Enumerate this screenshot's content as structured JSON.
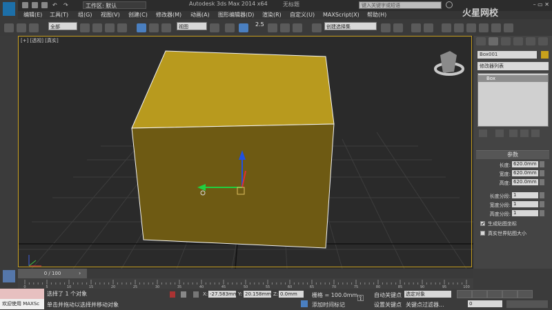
{
  "app": {
    "workspace": "工作区: 默认",
    "title": "Autodesk 3ds Max  2014 x64",
    "file": "无标题",
    "search_placeholder": "键入关键字或短语"
  },
  "menu": [
    "编辑(E)",
    "工具(T)",
    "组(G)",
    "视图(V)",
    "创建(C)",
    "修改器(M)",
    "动画(A)",
    "图形编辑器(D)",
    "渲染(R)",
    "自定义(U)",
    "MAXScript(X)",
    "帮助(H)"
  ],
  "toolbar": {
    "selection_filter": "全部",
    "ref_coord": "视图",
    "named_selection": "创建选择集",
    "snap_label": "2.5"
  },
  "viewport": {
    "label": "[+] [透视] [真实]",
    "object_color": "#c8a11b"
  },
  "command_panel": {
    "object_name": "Box001",
    "object_color": "#c8a11b",
    "modifier_list": "修改器列表",
    "stack_item": "Box",
    "rollout_title": "参数",
    "params": [
      {
        "label": "长度:",
        "value": "620.0mm"
      },
      {
        "label": "宽度:",
        "value": "620.0mm"
      },
      {
        "label": "高度:",
        "value": "620.0mm"
      }
    ],
    "segments": [
      {
        "label": "长度分段:",
        "value": "1"
      },
      {
        "label": "宽度分段:",
        "value": "1"
      },
      {
        "label": "高度分段:",
        "value": "1"
      }
    ],
    "checkboxes": [
      {
        "label": "生成贴图坐标",
        "checked": true,
        "mark": "✔"
      },
      {
        "label": "真实世界贴图大小",
        "checked": false,
        "mark": ""
      }
    ]
  },
  "timeline": {
    "frame_label": "0 / 100",
    "ticks": [
      "0",
      "5",
      "10",
      "15",
      "20",
      "25",
      "30",
      "35",
      "40",
      "45",
      "50",
      "55",
      "60",
      "65",
      "70",
      "75",
      "80",
      "85",
      "90",
      "95",
      "100"
    ]
  },
  "status": {
    "maxscript": "欢迎使用 MAXSc",
    "selected": "选择了 1 个对象",
    "prompt": "单击并拖动以选择并移动对象",
    "x_label": "X:",
    "x": "-27.583mm",
    "y_label": "Y:",
    "y": "20.158mm",
    "z_label": "Z:",
    "z": "0.0mm",
    "grid": "栅格 = 100.0mm",
    "add_time_tag": "添加时间标记",
    "auto_key": "自动关键点",
    "selected_object": "选定对象",
    "set_key": "设置关键点",
    "key_filters": "关键点过滤器...",
    "frame": "0"
  },
  "watermark": "火星网校"
}
